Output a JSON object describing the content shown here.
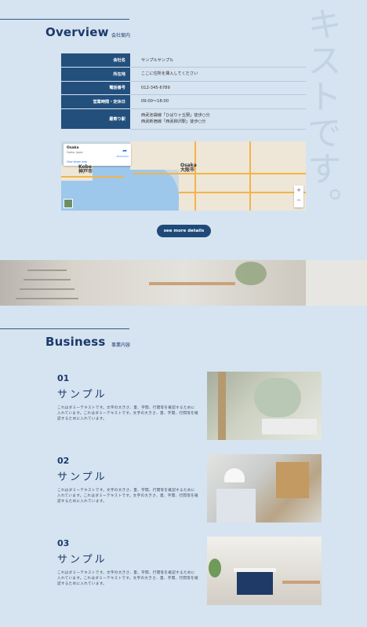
{
  "vertical_text": "キストです。",
  "overview": {
    "title": "Overview",
    "subtitle": "会社案内",
    "rows": [
      {
        "key": "会社名",
        "value": "サンプルサンプル"
      },
      {
        "key": "所在地",
        "value": "ここに住所を挿入してください"
      },
      {
        "key": "電話番号",
        "value": "012-345-6789"
      },
      {
        "key": "営業時間・定休日",
        "value": "09:00〜18:00"
      },
      {
        "key": "最寄り駅",
        "value": "西武池袋線「ひばりヶ丘駅」徒歩○分",
        "value2": "西武新宿線「西武柳沢駅」徒歩○分"
      }
    ],
    "button_label": "see more details"
  },
  "map": {
    "place_name": "Osaka",
    "place_sub": "Osaka, Japan",
    "view_larger": "View larger map",
    "directions": "Directions",
    "cities": [
      {
        "name": "Kobe\n神戸市"
      },
      {
        "name": "Osaka\n大阪市"
      }
    ],
    "zoom_in": "+",
    "zoom_out": "−"
  },
  "business": {
    "title": "Business",
    "subtitle": "事業内容",
    "items": [
      {
        "num": "01",
        "heading": "サンプル",
        "text": "これはダミーテキストです。文字の大きさ、量、字間、行間等を確認するために入れています。これはダミーテキストです。文字の大きさ、量、字間、行間等を確認するために入れています。"
      },
      {
        "num": "02",
        "heading": "サンプル",
        "text": "これはダミーテキストです。文字の大きさ、量、字間、行間等を確認するために入れています。これはダミーテキストです。文字の大きさ、量、字間、行間等を確認するために入れています。"
      },
      {
        "num": "03",
        "heading": "サンプル",
        "text": "これはダミーテキストです。文字の大きさ、量、字間、行間等を確認するために入れています。これはダミーテキストです。文字の大きさ、量、字間、行間等を確認するために入れています。"
      }
    ]
  }
}
